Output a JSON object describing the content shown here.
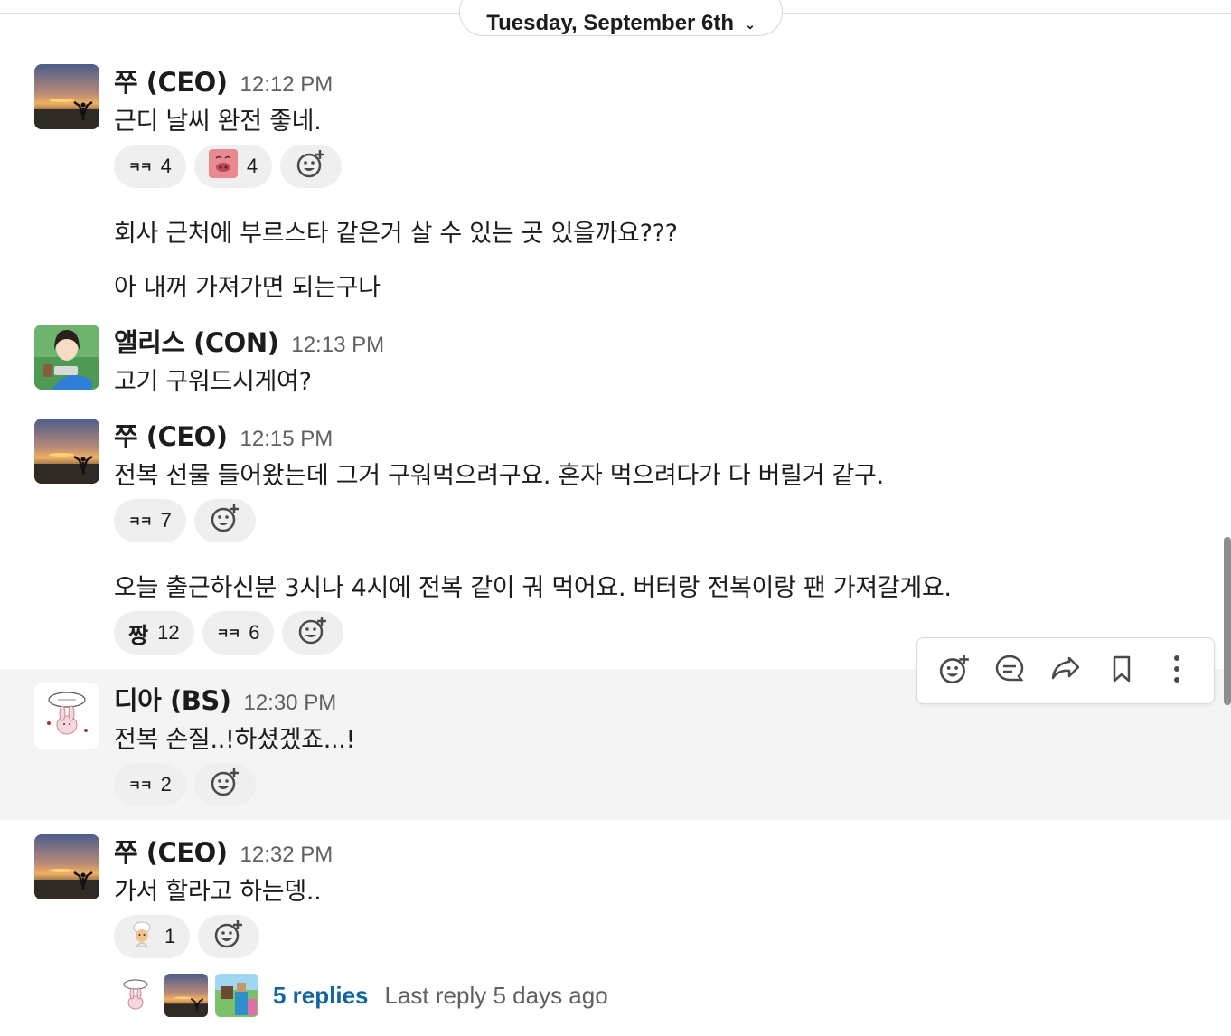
{
  "date_divider": {
    "label": "Tuesday, September 6th"
  },
  "messages": [
    {
      "author": "쭈 (CEO)",
      "time": "12:12 PM",
      "lines": [
        "근디 날씨 완전 좋네.",
        "회사 근처에 부르스타 같은거 살 수 있는 곳 있을까요???",
        "아 내꺼 가져가면 되는구나"
      ],
      "reactions": [
        {
          "emoji": "ㅋㅋ",
          "count": "4"
        },
        {
          "emoji": "pig",
          "count": "4"
        }
      ]
    },
    {
      "author": "앨리스 (CON)",
      "time": "12:13 PM",
      "lines": [
        "고기 구워드시게여?"
      ]
    },
    {
      "author": "쭈 (CEO)",
      "time": "12:15 PM",
      "lines": [
        "전복 선물 들어왔는데 그거 구워먹으려구요. 혼자 먹으려다가 다 버릴거 같구.",
        "오늘 출근하신분 3시나 4시에 전복 같이 궈 먹어요. 버터랑 전복이랑 팬 가져갈게요."
      ],
      "reactions": [
        {
          "emoji": "ㅋㅋ",
          "count": "7"
        }
      ],
      "reactions2": [
        {
          "emoji": "짱",
          "count": "12"
        },
        {
          "emoji": "ㅋㅋ",
          "count": "6"
        }
      ]
    },
    {
      "author": "디아 (BS)",
      "time": "12:30 PM",
      "lines": [
        "전복 손질..!하셨겠죠...!"
      ],
      "reactions": [
        {
          "emoji": "ㅋㅋ",
          "count": "2"
        }
      ]
    },
    {
      "author": "쭈 (CEO)",
      "time": "12:32 PM",
      "lines": [
        "가서 할라고 하는뎅.."
      ],
      "reactions": [
        {
          "emoji": "chef",
          "count": "1"
        }
      ],
      "thread": {
        "replies": "5 replies",
        "last_reply": "Last reply 5 days ago"
      }
    }
  ],
  "toolbar": {
    "icons": [
      "add-reaction-icon",
      "reply-in-thread-icon",
      "share-icon",
      "bookmark-icon",
      "more-actions-icon"
    ]
  },
  "colors": {
    "link": "#1264a3",
    "hover_bg": "#f4f4f4",
    "reaction_bg": "#efefef"
  }
}
